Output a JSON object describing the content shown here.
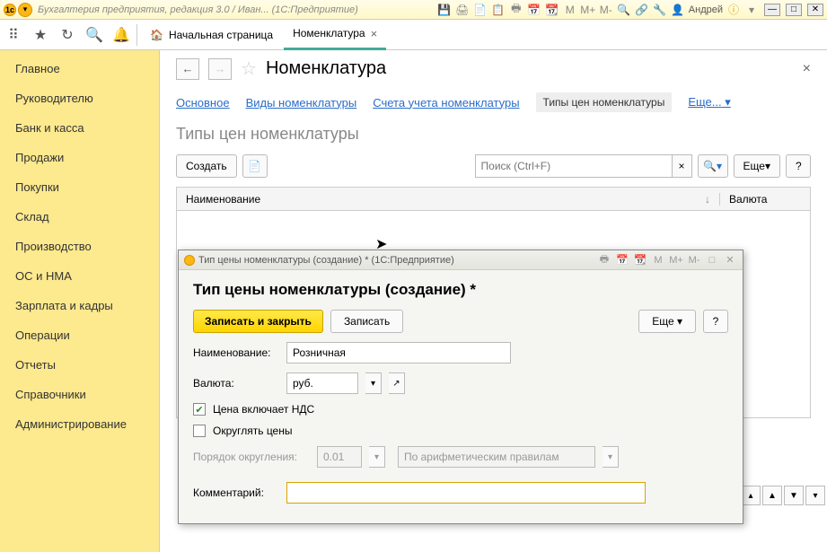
{
  "titlebar": {
    "title": "Бухгалтерия предприятия, редакция 3.0 / Иван...  (1С:Предприятие)",
    "user": "Андрей",
    "m_labels": [
      "M",
      "M+",
      "M-"
    ]
  },
  "toolbar": {
    "home": "Начальная страница",
    "tab": "Номенклатура"
  },
  "sidebar": {
    "items": [
      "Главное",
      "Руководителю",
      "Банк и касса",
      "Продажи",
      "Покупки",
      "Склад",
      "Производство",
      "ОС и НМА",
      "Зарплата и кадры",
      "Операции",
      "Отчеты",
      "Справочники",
      "Администрирование"
    ]
  },
  "main": {
    "title": "Номенклатура",
    "links": [
      "Основное",
      "Виды номенклатуры",
      "Счета учета номенклатуры",
      "Типы цен номенклатуры"
    ],
    "more": "Еще...",
    "subtitle": "Типы цен номенклатуры",
    "create": "Создать",
    "search_ph": "Поиск (Ctrl+F)",
    "more2": "Еще",
    "q": "?",
    "col1": "Наименование",
    "col2": "Валюта"
  },
  "dialog": {
    "wintitle": "Тип цены номенклатуры (создание) *  (1С:Предприятие)",
    "title": "Тип цены номенклатуры (создание) *",
    "save_close": "Записать и закрыть",
    "save": "Записать",
    "more": "Еще",
    "q": "?",
    "lbl_name": "Наименование:",
    "val_name": "Розничная",
    "lbl_cur": "Валюта:",
    "val_cur": "руб.",
    "cb1": "Цена включает НДС",
    "cb2": "Округлять цены",
    "lbl_round": "Порядок округления:",
    "val_round": "0.01",
    "val_round_rule": "По арифметическим правилам",
    "lbl_comment": "Комментарий:",
    "m_labels": [
      "M",
      "M+",
      "M-"
    ]
  }
}
